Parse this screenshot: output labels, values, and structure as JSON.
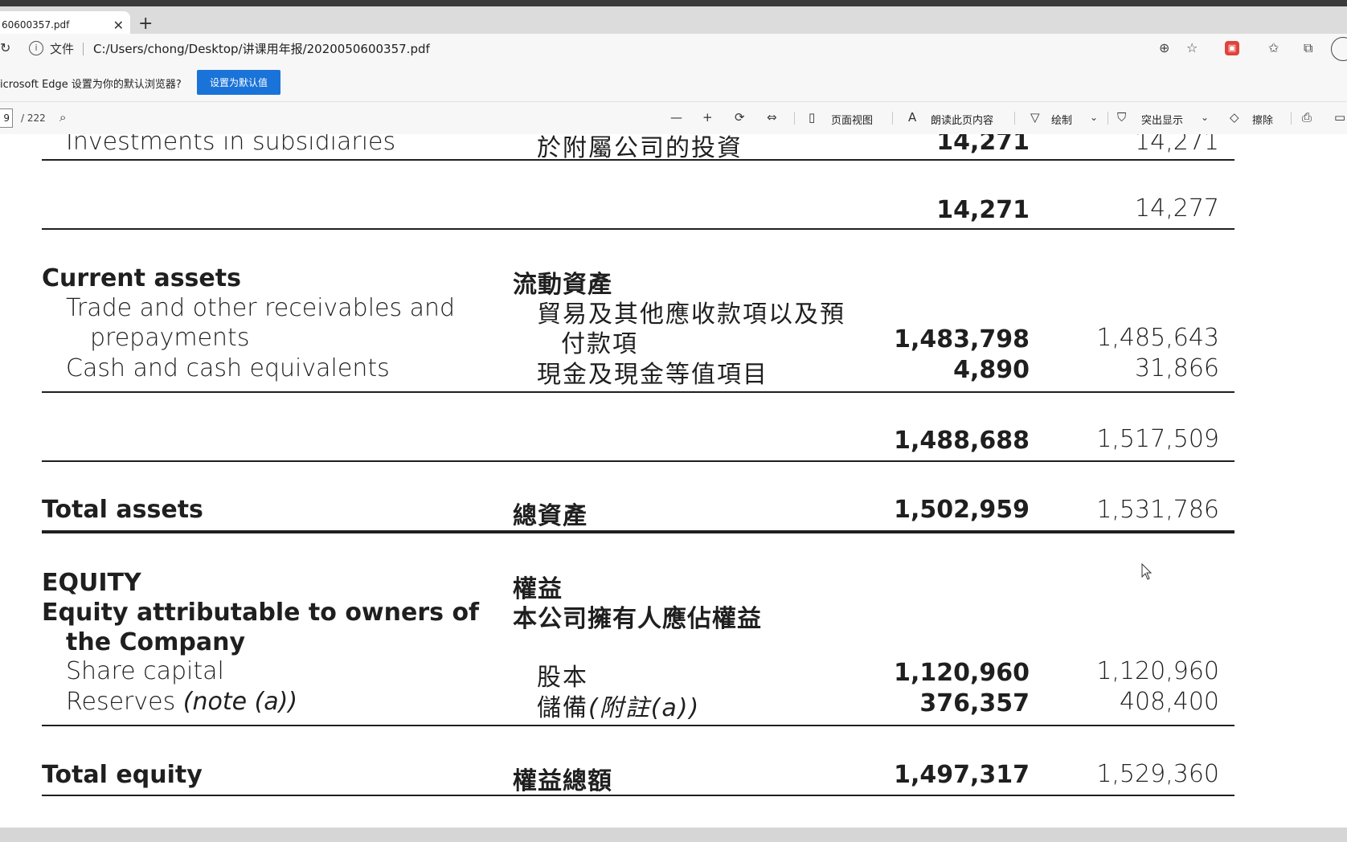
{
  "tab": {
    "title": "60600357.pdf",
    "close": "✕",
    "new": "+"
  },
  "address": {
    "reload": "↻",
    "info": "i",
    "scheme_label": "文件",
    "url": "C:/Users/chong/Desktop/讲课用年报/2020050600357.pdf"
  },
  "address_icons": {
    "zoom": "⊕",
    "favorite_add": "☆",
    "extension": "▣",
    "favorites": "✩",
    "collections": "⧉"
  },
  "infobar": {
    "message": "icrosoft Edge 设置为你的默认浏览器?",
    "button": "设置为默认值"
  },
  "pdf_toolbar": {
    "page_current": "9",
    "page_total": "/ 222",
    "search_icon": "⌕",
    "zoom_out": "—",
    "zoom_in": "+",
    "rotate": "⟳",
    "fit": "⇔",
    "page_view": "页面视图",
    "read_aloud": "朗读此页内容",
    "draw": "绘制",
    "highlight": "突出显示",
    "erase": "擦除",
    "print": "⎙",
    "dropdown": "⌄"
  },
  "statement": {
    "rows": [
      {
        "en": "Investments in subsidiaries",
        "zh": "於附屬公司的投資",
        "cur": "14,271",
        "prev": "14,271"
      },
      {
        "en": "",
        "zh": "",
        "cur": "14,271",
        "prev": "14,277"
      },
      {
        "en": "Current assets",
        "zh": "流動資產"
      },
      {
        "en": "Trade and other receivables and",
        "zh": "貿易及其他應收款項以及預"
      },
      {
        "en": "prepayments",
        "zh": "付款項",
        "cur": "1,483,798",
        "prev": "1,485,643"
      },
      {
        "en": "Cash and cash equivalents",
        "zh": "現金及現金等值項目",
        "cur": "4,890",
        "prev": "31,866"
      },
      {
        "en": "",
        "zh": "",
        "cur": "1,488,688",
        "prev": "1,517,509"
      },
      {
        "en": "Total assets",
        "zh": "總資產",
        "cur": "1,502,959",
        "prev": "1,531,786"
      },
      {
        "en": "EQUITY",
        "zh": "權益"
      },
      {
        "en": "Equity attributable to owners of",
        "zh": "本公司擁有人應佔權益"
      },
      {
        "en": "the Company",
        "zh": ""
      },
      {
        "en": "Share capital",
        "zh": "股本",
        "cur": "1,120,960",
        "prev": "1,120,960"
      },
      {
        "en": "Reserves ",
        "en_italic": "(note (a))",
        "zh": "儲備",
        "zh_italic": "(附註(a))",
        "cur": "376,357",
        "prev": "408,400"
      },
      {
        "en": "Total equity",
        "zh": "權益總額",
        "cur": "1,497,317",
        "prev": "1,529,360"
      }
    ]
  }
}
